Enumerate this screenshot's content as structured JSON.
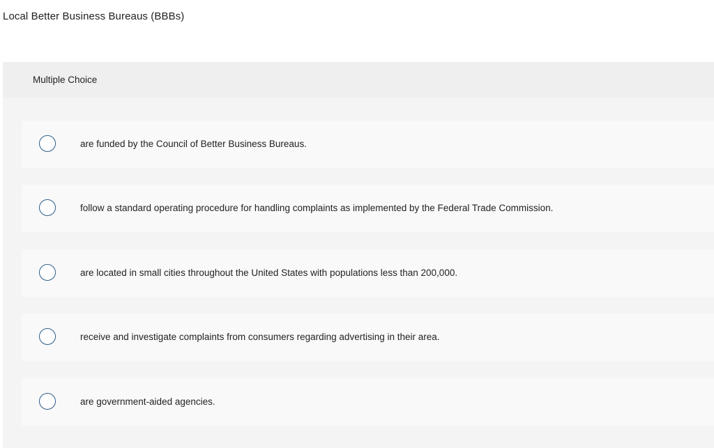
{
  "question": {
    "text": "Local Better Business Bureaus (BBBs)"
  },
  "panel": {
    "header_label": "Multiple Choice",
    "choices": [
      {
        "text": "are funded by the Council of Better Business Bureaus."
      },
      {
        "text": "follow a standard operating procedure for handling complaints as implemented by the Federal Trade Commission."
      },
      {
        "text": "are located in small cities throughout the United States with populations less than 200,000."
      },
      {
        "text": "receive and investigate complaints from consumers regarding advertising in their area."
      },
      {
        "text": "are government-aided agencies."
      }
    ]
  },
  "colors": {
    "radio_border": "#2e5b8a",
    "panel_background": "#f2f2f2",
    "choice_background": "#f9f9f9"
  }
}
